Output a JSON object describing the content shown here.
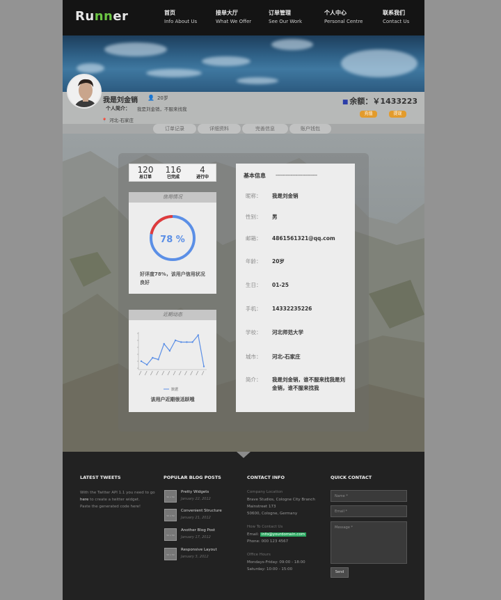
{
  "header": {
    "logo": {
      "part1": "Ru",
      "part2": "nn",
      "part3": "er"
    },
    "nav": [
      {
        "zh": "首页",
        "en": "Info About Us"
      },
      {
        "zh": "接单大厅",
        "en": "What We Offer"
      },
      {
        "zh": "订单管理",
        "en": "See Our Work"
      },
      {
        "zh": "个人中心",
        "en": "Personal Centre"
      },
      {
        "zh": "联系我们",
        "en": "Contact Us"
      }
    ]
  },
  "profile": {
    "name": "我是刘金销",
    "age": "20岁",
    "intro_label": "个人简介：",
    "intro_value": "我是刘金销，不服来找我",
    "location": "河北-石家庄",
    "balance": "余额：￥1433223",
    "recharge_btn": "充值",
    "withdraw_btn": "提现"
  },
  "tabs": [
    "订单记录",
    "详细资料",
    "完善信息",
    "账户钱包"
  ],
  "stats": [
    {
      "value": "120",
      "label": "总订单"
    },
    {
      "value": "116",
      "label": "已完成"
    },
    {
      "value": "4",
      "label": "进行中"
    }
  ],
  "credit": {
    "title": "信用情况",
    "percent_label": "78 %",
    "percent": 78,
    "text": "好评度78%，该用户信用状况良好",
    "colors": {
      "track": "#5b8fe6",
      "bad": "#e03b3b"
    }
  },
  "activity": {
    "title": "近期动态",
    "legend": "数据",
    "summary": "该用户近期很活跃哦"
  },
  "chart_data": {
    "type": "line",
    "title": "近期动态",
    "series": [
      {
        "name": "数据",
        "values": [
          2,
          1,
          3,
          2.5,
          7,
          5,
          8,
          7.5,
          7.5,
          7.5,
          9.5,
          0.5
        ]
      }
    ],
    "ylim": [
      0,
      10
    ],
    "color": "#5b8fe6"
  },
  "info": {
    "title": "基本信息",
    "dashes": "-------------------------",
    "rows": [
      {
        "k": "昵称：",
        "v": "我是刘金销"
      },
      {
        "k": "性别：",
        "v": "男"
      },
      {
        "k": "邮箱：",
        "v": "4861561321@qq.com"
      },
      {
        "k": "年龄：",
        "v": "20岁"
      },
      {
        "k": "生日：",
        "v": "01-25"
      },
      {
        "k": "手机：",
        "v": "14332235226"
      },
      {
        "k": "学校：",
        "v": "河北师范大学"
      },
      {
        "k": "城市：",
        "v": "河北-石家庄"
      }
    ],
    "bio_label": "简介：",
    "bio": "我是刘金销，谁不服来找我是刘金销，谁不服来找我"
  },
  "footer": {
    "tweets": {
      "title": "LATEST TWEETS",
      "line1": "With the Twitter API 1.1 you need to go",
      "here": "here",
      "line2": " to create a twitter widget.",
      "line3": "Paste the generated code here!"
    },
    "blog": {
      "title": "POPULAR BLOG POSTS",
      "thumb": "50 x 50",
      "posts": [
        {
          "t": "Pretty Widgets",
          "d": "January 22, 2012"
        },
        {
          "t": "Convenient Structure",
          "d": "January 21, 2012"
        },
        {
          "t": "Another Blog Post",
          "d": "January 17, 2012"
        },
        {
          "t": "Responsive Layout",
          "d": "January 3, 2012"
        }
      ]
    },
    "contact": {
      "title": "CONTACT INFO",
      "company_label": "Company Location",
      "address": [
        "Brave Studios, Cologne City Branch",
        "Mainstreet 173",
        "50600, Cologne, Germany"
      ],
      "how_label": "How To Contact Us",
      "email_label": "Email:",
      "email": "info@yourdomain.com",
      "phone": "Phone: 000 123 4567",
      "hours_label": "Office Hours",
      "hours": [
        "Mondays-Friday: 09:00 - 18:00",
        "Saturday: 10:00 - 15:00"
      ]
    },
    "quick": {
      "title": "QUICK CONTACT",
      "name_ph": "Name *",
      "email_ph": "Email *",
      "msg_ph": "Message *",
      "send": "Send"
    }
  }
}
